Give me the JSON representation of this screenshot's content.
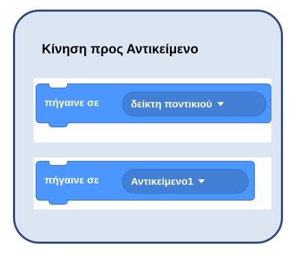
{
  "title": "Κίνηση προς  Αντικείμενο",
  "blocks": [
    {
      "label": "πήγαινε σε",
      "dropdown": "δείκτη ποντικιού"
    },
    {
      "label": "πήγαινε σε",
      "dropdown": "Αντικείμενο1"
    }
  ],
  "colors": {
    "card_background": "#dce6f2",
    "card_border": "#2f4b7c",
    "motion_block": "#4c97ff",
    "motion_block_border": "#3373cc",
    "dropdown_fill": "#4280d7"
  },
  "icons": [
    "caret-down-icon"
  ]
}
